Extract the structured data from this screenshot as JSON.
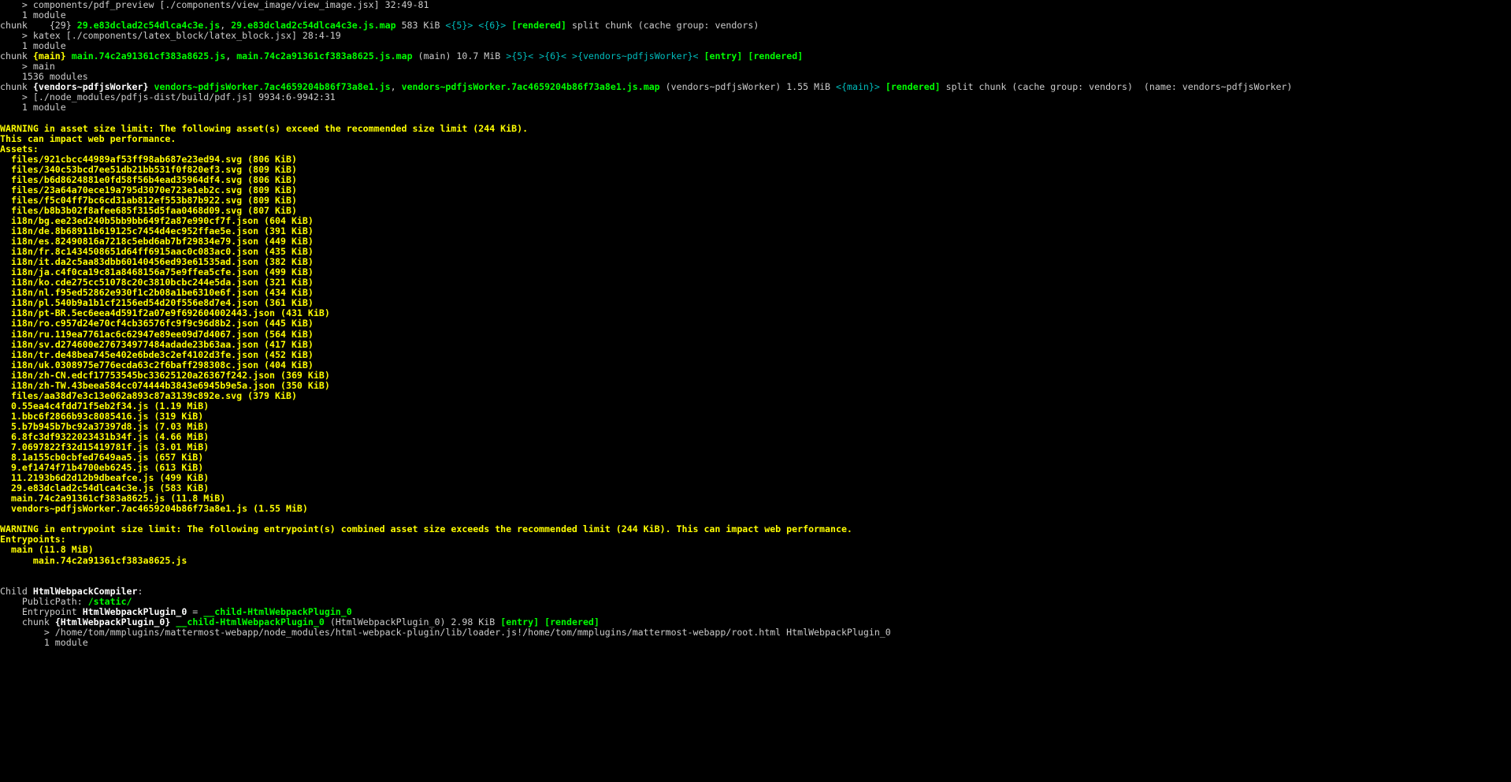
{
  "terminal": {
    "type": "webpack-build-output",
    "colors": {
      "background": "#000000",
      "default_text": "#cccccc",
      "module_green": "#00c000",
      "chunk_cyan": "#00bcbc",
      "warning_yellow": "#cdcd00",
      "bright_white": "#ffffff"
    }
  },
  "lines": [
    {
      "id": "line-1",
      "indent": 4,
      "segments": [
        {
          "text": "> components/pdf_preview [./components/view_image/view_image.jsx] 32:49-81",
          "color": "white"
        }
      ]
    },
    {
      "id": "line-2",
      "indent": 4,
      "segments": [
        {
          "text": "1 module",
          "color": "white"
        }
      ]
    },
    {
      "id": "line-3",
      "indent": 0,
      "segments": [
        {
          "text": "chunk",
          "color": "white"
        },
        {
          "text": "    {29} ",
          "color": "white"
        },
        {
          "text": "29.e83dclad2c54dlca4c3e.js",
          "color": "bold-green"
        },
        {
          "text": ", ",
          "color": "white"
        },
        {
          "text": "29.e83dclad2c54dlca4c3e.js.map",
          "color": "bold-green"
        },
        {
          "text": " 583 KiB ",
          "color": "white"
        },
        {
          "text": "<{5}> <{6}>",
          "color": "cyan"
        },
        {
          "text": " ",
          "color": "white"
        },
        {
          "text": "[rendered]",
          "color": "bold-green"
        },
        {
          "text": " split chunk (cache group: vendors)",
          "color": "white"
        }
      ]
    },
    {
      "id": "line-4",
      "indent": 4,
      "segments": [
        {
          "text": "> katex [./components/latex_block/latex_block.jsx] 28:4-19",
          "color": "white"
        }
      ]
    },
    {
      "id": "line-5",
      "indent": 4,
      "segments": [
        {
          "text": "1 module",
          "color": "white"
        }
      ]
    },
    {
      "id": "line-6",
      "indent": 0,
      "segments": [
        {
          "text": "chunk ",
          "color": "white"
        },
        {
          "text": "{main}",
          "color": "bold-yellow"
        },
        {
          "text": " ",
          "color": "white"
        },
        {
          "text": "main.74c2a91361cf383a8625.js",
          "color": "bold-green"
        },
        {
          "text": ", ",
          "color": "white"
        },
        {
          "text": "main.74c2a91361cf383a8625.js.map",
          "color": "bold-green"
        },
        {
          "text": " (main) 10.7 MiB ",
          "color": "white"
        },
        {
          "text": ">{5}< >{6}< >{vendors~pdfjsWorker}<",
          "color": "cyan"
        },
        {
          "text": " ",
          "color": "white"
        },
        {
          "text": "[entry]",
          "color": "bold-green"
        },
        {
          "text": " ",
          "color": "white"
        },
        {
          "text": "[rendered]",
          "color": "bold-green"
        }
      ]
    },
    {
      "id": "line-7",
      "indent": 4,
      "segments": [
        {
          "text": "> main",
          "color": "white"
        }
      ]
    },
    {
      "id": "line-8",
      "indent": 4,
      "segments": [
        {
          "text": "1536 modules",
          "color": "white"
        }
      ]
    },
    {
      "id": "line-9",
      "indent": 0,
      "segments": [
        {
          "text": "chunk ",
          "color": "white"
        },
        {
          "text": "{vendors~pdfjsWorker}",
          "color": "bold-white"
        },
        {
          "text": " ",
          "color": "white"
        },
        {
          "text": "vendors~pdfjsWorker.7ac4659204b86f73a8e1.js",
          "color": "bold-green"
        },
        {
          "text": ", ",
          "color": "white"
        },
        {
          "text": "vendors~pdfjsWorker.7ac4659204b86f73a8e1.js.map",
          "color": "bold-green"
        },
        {
          "text": " (vendors~pdfjsWorker) 1.55 MiB ",
          "color": "white"
        },
        {
          "text": "<{main}>",
          "color": "cyan"
        },
        {
          "text": " ",
          "color": "white"
        },
        {
          "text": "[rendered]",
          "color": "bold-green"
        },
        {
          "text": " split chunk (cache group: vendors)  (name: vendors~pdfjsWorker)",
          "color": "white"
        }
      ]
    },
    {
      "id": "line-10",
      "indent": 4,
      "segments": [
        {
          "text": "> [./node_modules/pdfjs-dist/build/pdf.js] 9934:6-9942:31",
          "color": "white"
        }
      ]
    },
    {
      "id": "line-11",
      "indent": 4,
      "segments": [
        {
          "text": "1 module",
          "color": "white"
        }
      ]
    },
    {
      "id": "blank-1",
      "blank": true
    },
    {
      "id": "line-12",
      "indent": 0,
      "segments": [
        {
          "text": "WARNING in asset size limit: The following asset(s) exceed the recommended size limit (244 KiB).",
          "color": "bold-yellow"
        }
      ]
    },
    {
      "id": "line-13",
      "indent": 0,
      "segments": [
        {
          "text": "This can impact web performance.",
          "color": "bold-yellow"
        }
      ]
    },
    {
      "id": "line-14",
      "indent": 0,
      "segments": [
        {
          "text": "Assets:",
          "color": "bold-yellow"
        }
      ]
    },
    {
      "id": "asset-1",
      "indent": 2,
      "segments": [
        {
          "text": "files/921cbcc44989af53ff98ab687e23ed94.svg (806 KiB)",
          "color": "bold-yellow"
        }
      ]
    },
    {
      "id": "asset-2",
      "indent": 2,
      "segments": [
        {
          "text": "files/340c53bcd7ee51db21bb531f0f820ef3.svg (809 KiB)",
          "color": "bold-yellow"
        }
      ]
    },
    {
      "id": "asset-3",
      "indent": 2,
      "segments": [
        {
          "text": "files/b6d8624881e0fd58f56b4ead35964df4.svg (806 KiB)",
          "color": "bold-yellow"
        }
      ]
    },
    {
      "id": "asset-4",
      "indent": 2,
      "segments": [
        {
          "text": "files/23a64a70ece19a795d3070e723e1eb2c.svg (809 KiB)",
          "color": "bold-yellow"
        }
      ]
    },
    {
      "id": "asset-5",
      "indent": 2,
      "segments": [
        {
          "text": "files/f5c04ff7bc6cd31ab812ef553b87b922.svg (809 KiB)",
          "color": "bold-yellow"
        }
      ]
    },
    {
      "id": "asset-6",
      "indent": 2,
      "segments": [
        {
          "text": "files/b8b3b02f8afee685f315d5faa0468d09.svg (807 KiB)",
          "color": "bold-yellow"
        }
      ]
    },
    {
      "id": "asset-7",
      "indent": 2,
      "segments": [
        {
          "text": "i18n/bg.ee23ed240b5bb9bb649f2a87e990cf7f.json (604 KiB)",
          "color": "bold-yellow"
        }
      ]
    },
    {
      "id": "asset-8",
      "indent": 2,
      "segments": [
        {
          "text": "i18n/de.8b68911b619125c7454d4ec952ffae5e.json (391 KiB)",
          "color": "bold-yellow"
        }
      ]
    },
    {
      "id": "asset-9",
      "indent": 2,
      "segments": [
        {
          "text": "i18n/es.82490816a7218c5ebd6ab7bf29834e79.json (449 KiB)",
          "color": "bold-yellow"
        }
      ]
    },
    {
      "id": "asset-10",
      "indent": 2,
      "segments": [
        {
          "text": "i18n/fr.8c1434508651d64ff6915aac0c083ac0.json (435 KiB)",
          "color": "bold-yellow"
        }
      ]
    },
    {
      "id": "asset-11",
      "indent": 2,
      "segments": [
        {
          "text": "i18n/it.da2c5aa83dbb60140456ed93e61535ad.json (382 KiB)",
          "color": "bold-yellow"
        }
      ]
    },
    {
      "id": "asset-12",
      "indent": 2,
      "segments": [
        {
          "text": "i18n/ja.c4f0ca19c81a8468156a75e9ffea5cfe.json (499 KiB)",
          "color": "bold-yellow"
        }
      ]
    },
    {
      "id": "asset-13",
      "indent": 2,
      "segments": [
        {
          "text": "i18n/ko.cde275cc51078c20c3810bcbc244e5da.json (321 KiB)",
          "color": "bold-yellow"
        }
      ]
    },
    {
      "id": "asset-14",
      "indent": 2,
      "segments": [
        {
          "text": "i18n/nl.f95ed52862e930f1c2b08a1be6310e6f.json (434 KiB)",
          "color": "bold-yellow"
        }
      ]
    },
    {
      "id": "asset-15",
      "indent": 2,
      "segments": [
        {
          "text": "i18n/pl.540b9a1b1cf2156ed54d20f556e8d7e4.json (361 KiB)",
          "color": "bold-yellow"
        }
      ]
    },
    {
      "id": "asset-16",
      "indent": 2,
      "segments": [
        {
          "text": "i18n/pt-BR.5ec6eea4d591f2a07e9f692604002443.json (431 KiB)",
          "color": "bold-yellow"
        }
      ]
    },
    {
      "id": "asset-17",
      "indent": 2,
      "segments": [
        {
          "text": "i18n/ro.c957d24e70cf4cb36576fc9f9c96d8b2.json (445 KiB)",
          "color": "bold-yellow"
        }
      ]
    },
    {
      "id": "asset-18",
      "indent": 2,
      "segments": [
        {
          "text": "i18n/ru.119ea7761ac6c62947e89ee09d7d4067.json (564 KiB)",
          "color": "bold-yellow"
        }
      ]
    },
    {
      "id": "asset-19",
      "indent": 2,
      "segments": [
        {
          "text": "i18n/sv.d274600e276734977484adade23b63aa.json (417 KiB)",
          "color": "bold-yellow"
        }
      ]
    },
    {
      "id": "asset-20",
      "indent": 2,
      "segments": [
        {
          "text": "i18n/tr.de48bea745e402e6bde3c2ef4102d3fe.json (452 KiB)",
          "color": "bold-yellow"
        }
      ]
    },
    {
      "id": "asset-21",
      "indent": 2,
      "segments": [
        {
          "text": "i18n/uk.0308975e776ecda63c2f6baff298308c.json (404 KiB)",
          "color": "bold-yellow"
        }
      ]
    },
    {
      "id": "asset-22",
      "indent": 2,
      "segments": [
        {
          "text": "i18n/zh-CN.edcf17753545bc33625120a26367f242.json (369 KiB)",
          "color": "bold-yellow"
        }
      ]
    },
    {
      "id": "asset-23",
      "indent": 2,
      "segments": [
        {
          "text": "i18n/zh-TW.43beea584cc074444b3843e6945b9e5a.json (350 KiB)",
          "color": "bold-yellow"
        }
      ]
    },
    {
      "id": "asset-24",
      "indent": 2,
      "segments": [
        {
          "text": "files/aa38d7e3c13e062a893c87a3139c892e.svg (379 KiB)",
          "color": "bold-yellow"
        }
      ]
    },
    {
      "id": "asset-25",
      "indent": 2,
      "segments": [
        {
          "text": "0.55ea4c4fdd71f5eb2f34.js (1.19 MiB)",
          "color": "bold-yellow"
        }
      ]
    },
    {
      "id": "asset-26",
      "indent": 2,
      "segments": [
        {
          "text": "1.bbc6f2866b93c8085416.js (319 KiB)",
          "color": "bold-yellow"
        }
      ]
    },
    {
      "id": "asset-27",
      "indent": 2,
      "segments": [
        {
          "text": "5.b7b945b7bc92a37397d8.js (7.03 MiB)",
          "color": "bold-yellow"
        }
      ]
    },
    {
      "id": "asset-28",
      "indent": 2,
      "segments": [
        {
          "text": "6.8fc3df9322023431b34f.js (4.66 MiB)",
          "color": "bold-yellow"
        }
      ]
    },
    {
      "id": "asset-29",
      "indent": 2,
      "segments": [
        {
          "text": "7.0697822f32d15419781f.js (3.01 MiB)",
          "color": "bold-yellow"
        }
      ]
    },
    {
      "id": "asset-30",
      "indent": 2,
      "segments": [
        {
          "text": "8.1a155cb0cbfed7649aa5.js (657 KiB)",
          "color": "bold-yellow"
        }
      ]
    },
    {
      "id": "asset-31",
      "indent": 2,
      "segments": [
        {
          "text": "9.ef1474f71b4700eb6245.js (613 KiB)",
          "color": "bold-yellow"
        }
      ]
    },
    {
      "id": "asset-32",
      "indent": 2,
      "segments": [
        {
          "text": "11.2193b6d2d12b9dbeafce.js (499 KiB)",
          "color": "bold-yellow"
        }
      ]
    },
    {
      "id": "asset-33",
      "indent": 2,
      "segments": [
        {
          "text": "29.e83dclad2c54dlca4c3e.js (583 KiB)",
          "color": "bold-yellow"
        }
      ]
    },
    {
      "id": "asset-34",
      "indent": 2,
      "segments": [
        {
          "text": "main.74c2a91361cf383a8625.js (11.8 MiB)",
          "color": "bold-yellow"
        }
      ]
    },
    {
      "id": "asset-35",
      "indent": 2,
      "segments": [
        {
          "text": "vendors~pdfjsWorker.7ac4659204b86f73a8e1.js (1.55 MiB)",
          "color": "bold-yellow"
        }
      ]
    },
    {
      "id": "blank-2",
      "blank": true
    },
    {
      "id": "line-15",
      "indent": 0,
      "segments": [
        {
          "text": "WARNING in entrypoint size limit: The following entrypoint(s) combined asset size exceeds the recommended limit (244 KiB). This can impact web performance.",
          "color": "bold-yellow"
        }
      ]
    },
    {
      "id": "line-16",
      "indent": 0,
      "segments": [
        {
          "text": "Entrypoints:",
          "color": "bold-yellow"
        }
      ]
    },
    {
      "id": "line-17",
      "indent": 2,
      "segments": [
        {
          "text": "main (11.8 MiB)",
          "color": "bold-yellow"
        }
      ]
    },
    {
      "id": "line-18",
      "indent": 6,
      "segments": [
        {
          "text": "main.74c2a91361cf383a8625.js",
          "color": "bold-yellow"
        }
      ]
    },
    {
      "id": "blank-3",
      "blank": true
    },
    {
      "id": "blank-4",
      "blank": true
    },
    {
      "id": "line-19",
      "indent": 0,
      "segments": [
        {
          "text": "Child ",
          "color": "white"
        },
        {
          "text": "HtmlWebpackCompiler",
          "color": "bold-white"
        },
        {
          "text": ":",
          "color": "white"
        }
      ]
    },
    {
      "id": "line-20",
      "indent": 4,
      "segments": [
        {
          "text": "PublicPath: ",
          "color": "white"
        },
        {
          "text": "/static/",
          "color": "bold-green"
        }
      ]
    },
    {
      "id": "line-21",
      "indent": 4,
      "segments": [
        {
          "text": "Entrypoint ",
          "color": "white"
        },
        {
          "text": "HtmlWebpackPlugin_0",
          "color": "bold-white"
        },
        {
          "text": " = ",
          "color": "white"
        },
        {
          "text": "__child-HtmlWebpackPlugin_0",
          "color": "bold-green"
        }
      ]
    },
    {
      "id": "line-22",
      "indent": 4,
      "segments": [
        {
          "text": "chunk ",
          "color": "white"
        },
        {
          "text": "{HtmlWebpackPlugin_0}",
          "color": "bold-white"
        },
        {
          "text": " ",
          "color": "white"
        },
        {
          "text": "__child-HtmlWebpackPlugin_0",
          "color": "bold-green"
        },
        {
          "text": " (HtmlWebpackPlugin_0) 2.98 KiB ",
          "color": "white"
        },
        {
          "text": "[entry]",
          "color": "bold-green"
        },
        {
          "text": " ",
          "color": "white"
        },
        {
          "text": "[rendered]",
          "color": "bold-green"
        }
      ]
    },
    {
      "id": "line-23",
      "indent": 8,
      "segments": [
        {
          "text": "> /home/tom/mmplugins/mattermost-webapp/node_modules/html-webpack-plugin/lib/loader.js!/home/tom/mmplugins/mattermost-webapp/root.html HtmlWebpackPlugin_0",
          "color": "white"
        }
      ]
    },
    {
      "id": "line-24",
      "indent": 8,
      "segments": [
        {
          "text": "1 module",
          "color": "white"
        }
      ]
    }
  ]
}
